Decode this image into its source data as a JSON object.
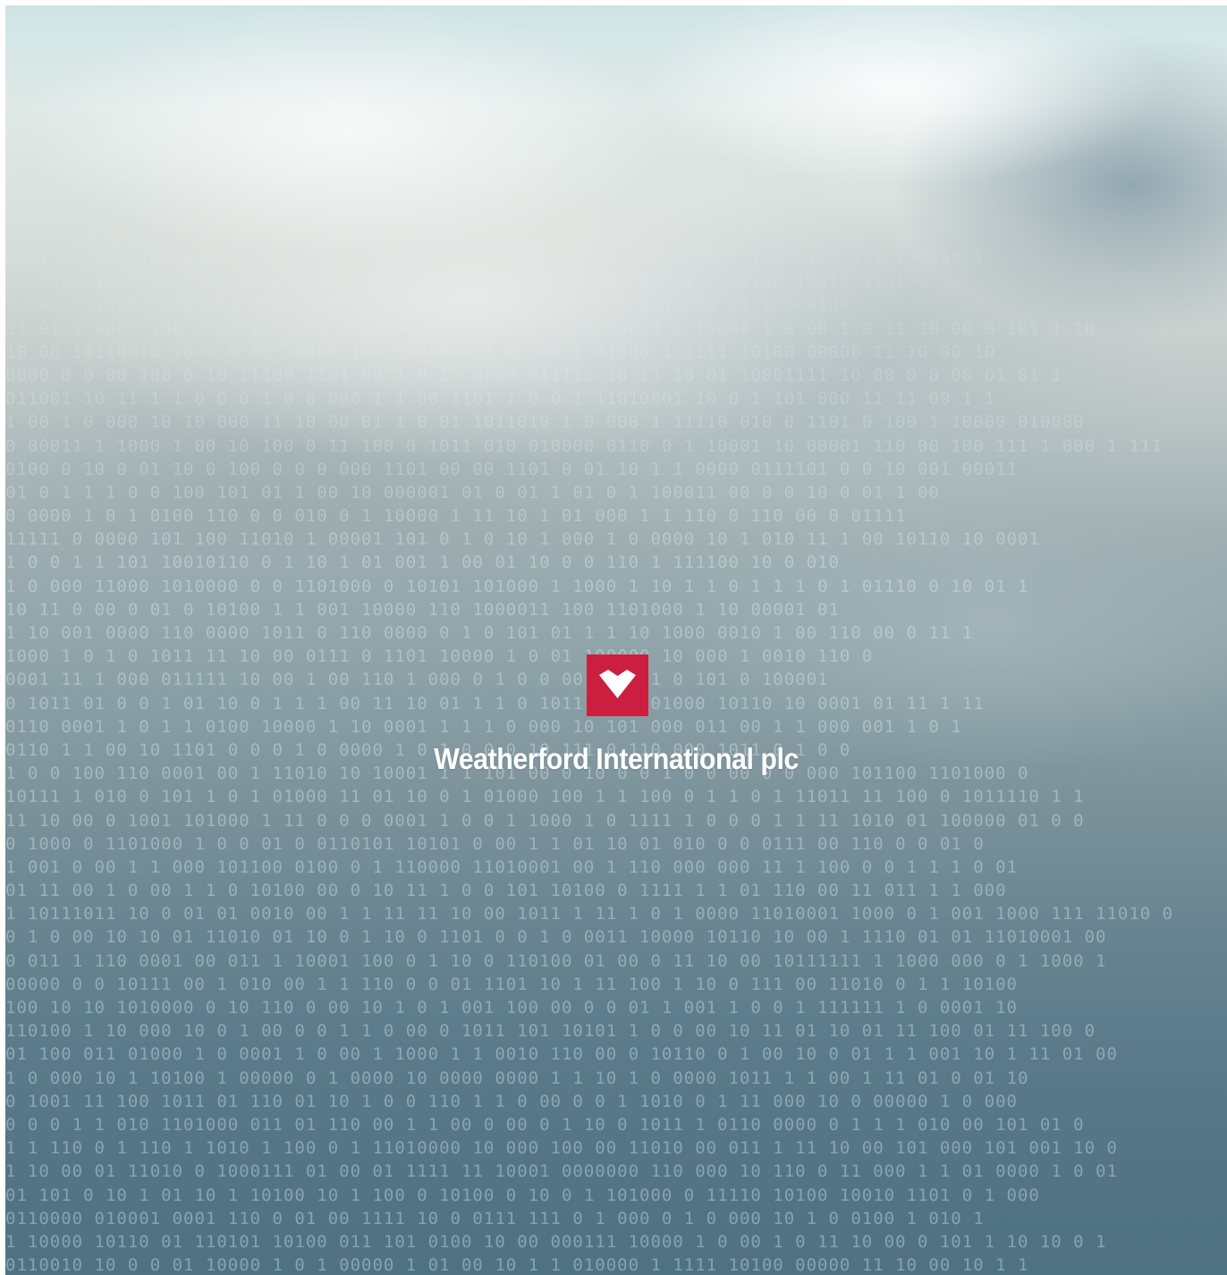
{
  "brand": {
    "name": "Weatherford International plc",
    "logo_icon": "weatherford-chevron-heart-icon",
    "logo_color": "#cc1f3f",
    "text_color": "#ffffff"
  },
  "background": {
    "description_colors": {
      "sky": "#cfe4e6",
      "clouds": "#dfe9e6",
      "water": "#4f7283"
    },
    "binary_rows": [
      "0001 0100 1110 0000 0101 1010 0110 1100 0101 1000 0 1 0 110 0000 1 101 0101 1 1 1 0000 1",
      "0110101 10 0 11 1000 10 1 1101 1011 11 01 1 1 1 0 101000 0 11110 10100 10010 1101 0",
      "1 000 0110000 1001 11 0001 1 0 1 00 11 1 1 100 1 000 0 1 0 1 000 10 1 0 0100",
      "11 01 1 0000 100 1 01 11 0111 0100 011 101 0100 10 00 00011 1 10000 1 0 00 1 0 11 10 00 0 101 1 10",
      "10 00 10110010 10 0 0 01 10000 1 0 1 00000 1 01 00 1 01000 1 1111 10100 00000 11 10 00 10",
      "0000 0 0 00 100 0 10 11100 1101 00 1 0 11 0000 011110 10 11 10 01 10001111 10 00 0 0 00 01 01 1",
      "011001 10 11 1 1 0 0 0 1 0 0 000 1 1 00 1101 1 0 0 1 11010001 10 0 1 101 000 11 11 00 1 1",
      "1 00 1 0 000 10 10 000 11 10 00 01 1 0 01 1011010 1 0 000 1 11110 010 0 1101 0 100 1 10000 010000",
      "0 00011 1 1000 1 00 10 100 0 11 100 0 1011 010 010000 0110 0 1 10001 10 00001 110 00 100 111 1 000 1 111",
      "0100 0 10 0 01 10 0 100 0 0 0 000 1101 00 00 1101 0 01 10 1 1 0000 0111101 0 0 10 001 00011",
      "01 0 1 1 1 0 0 100 101 01 1 00 10 000001 01 0 01 1 01 0 1 100011 00 0 0 10 0 01 1 00",
      "0 0000 1 0 1 0100 110 0 0 010 0 1 10000 1 11 10 1 01 000 1 1 110 0 110 00 0 01111",
      "11111 0 0000 101 100 11010 1 00001 101 0 1 0 10 1 000 1 0 0000 10 1 010 11 1 00 10110 10 0001",
      "1 0 0 1 1 101 10010110 0 1 10 1 01 001 1 00 01 10 0 0 110 1 111100 10 0 010",
      "1 0 000 11000 1010000 0 0 1101000 0 10101 101000 1 1000 1 10 1 1 0 1 1 1 0 1 01110 0 10 01 1",
      "10 11 0 00 0 01 0 10100 1 1 001 10000 110 1000011 100 1101000 1 10 00001 01",
      "1 10 001 0000 110 0000 1011 0 110 0000 0 1 0 101 01 1 1 10 1000 0010 1 00 110 00 0 11 1",
      "1000 1 0 1 0 1011 11 10 00 0111 0 1101 10000 1 0 01 100000 10 000 1 0010 110 0",
      "0001 11 1 000 011111 10 00 1 00 110 1 000 0 1 0 0 00 1 00 1 0 101 0 100001",
      "0 1011 01 0 0 1 01 10 0 1 1 1 00 11 10 01 1 1 0 1011 1 0 101000 10110 10 0001 01 11 1 11",
      "0110 0001 1 0 1 1 0100 10000 1 10 0001 1 1 1 0 000 10 101 000 011 00 1 1 000 001 1 0 1",
      "0110 1 1 00 10 1101 0 0 0 1 0 0000 1 0 1 0 0 0 10 111 0 110 000 1011 0 1 0 0",
      "1 0 0 100 110 0001 00 1 11010 10 10001 1 1 101 00 0 10 0 0 1 0 0 00 0 0 000 101100 1101000 0",
      "10111 1 010 0 101 1 0 1 01000 11 01 10 0 1 01000 100 1 1 100 0 1 1 0 1 11011 11 100 0 1011110 1 1",
      "11 10 00 0 1001 101000 1 11 0 0 0 0001 1 0 0 1 1000 1 0 1111 1 0 0 0 1 1 11 1010 01 100000 01 0 0",
      "0 1000 0 1101000 1 0 0 01 0 0110101 10101 0 00 1 1 01 10 01 010 0 0 0111 00 110 0 0 01 0",
      "1 001 0 00 1 1 000 101100 0100 0 1 110000 11010001 00 1 110 000 000 11 1 100 0 0 1 1 1 0 01",
      "01 11 00 1 0 00 1 1 0 10100 00 0 10 11 1 0 0 101 10100 0 1111 1 1 01 110 00 11 011 1 1 000",
      "1 10111011 10 0 01 01 0010 00 1 1 11 11 10 00 1011 1 11 1 0 1 0000 11010001 1000 0 1 001 1000 111 11010 0",
      "0 1 0 00 10 10 01 11010 01 10 0 1 10 0 1101 0 0 1 0 0011 10000 10110 10 00 1 1110 01 01 11010001 00",
      "0 011 1 110 0001 00 011 1 10001 100 0 1 10 0 110100 01 00 0 11 10 00 10111111 1 1000 000 0 1 1000 1",
      "00000 0 0 10111 00 1 010 00 1 1 110 0 0 01 1101 10 1 11 100 1 10 0 111 00 11010 0 1 1 10100",
      "100 10 10 1010000 0 10 110 0 00 10 1 0 1 001 100 00 0 0 01 1 001 1 0 0 1 111111 1 0 0001 10",
      "110100 1 10 000 10 0 1 00 0 0 1 1 0 00 0 1011 101 10101 1 0 0 00 10 11 01 10 01 11 100 01 11 100 0",
      "01 100 011 01000 1 0 0001 1 0 00 1 1000 1 1 0010 110 00 0 10110 0 1 00 10 0 01 1 1 001 10 1 11 01 00",
      "1 0 000 10 1 10100 1 00000 0 1 0000 10 0000 0000 1 1 10 1 0 0000 1011 1 1 00 1 11 01 0 01 10",
      "0 1001 11 100 1011 01 110 01 10 1 0 0 110 1 1 0 00 0 0 1 1010 0 1 11 000 10 0 00000 1 0 000",
      "0 0 0 1 1 010 1101000 011 01 110 00 1 1 00 0 00 0 1 10 0 1011 1 0110 0000 0 1 1 1 010 00 101 01 0",
      "1 1 110 0 1 110 1 1010 1 100 0 1 11010000 10 000 100 00 11010 00 011 1 11 10 00 101 000 101 001 10 0",
      "1 10 00 01 11010 0 1000111 01 00 01 1111 11 10001 0000000 110 000 10 110 0 11 000 1 1 01 0000 1 0 01",
      "01 101 0 10 1 01 10 1 10100 10 1 100 0 10100 0 10 0 1 101000 0 11110 10100 10010 1101 0 1 000",
      "0110000 010001 0001 110 0 01 00 1111 10 0 0111 111 0 1 000 0 1 0 000 10 1 0 0100 1 010 1",
      "1 10000 10110 01 110101 10100 011 101 0100 10 00 000111 10000 1 0 00 1 0 11 10 00 0 101 1 10 10 0 1",
      "0110010 10 0 0 01 10000 1 0 1 00000 1 01 00 10 1 1 010000 1 1111 10100 00000 11 10 00 10 1 1"
    ]
  }
}
